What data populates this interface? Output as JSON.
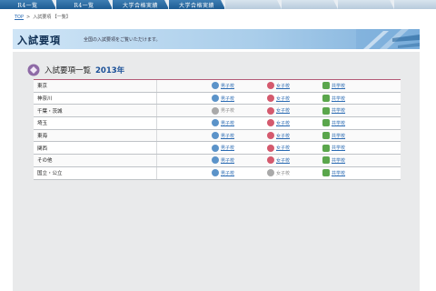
{
  "nav": {
    "tabs": [
      {
        "label": "R4一覧",
        "style": "dark"
      },
      {
        "label": "R4一覧",
        "style": "dark"
      },
      {
        "label": "大学合格実績",
        "style": "dark"
      },
      {
        "label": "大学合格実績",
        "style": "dark"
      },
      {
        "label": "",
        "style": "light"
      },
      {
        "label": "",
        "style": "light"
      },
      {
        "label": "",
        "style": "light"
      },
      {
        "label": "",
        "style": "light"
      }
    ]
  },
  "breadcrumb": {
    "top": "TOP",
    "separator": ">",
    "current": "入試要項 【一覧】"
  },
  "banner": {
    "title": "入試要項",
    "description": "全国の入試要項をご覧いただけます。"
  },
  "list": {
    "title": "入試要項一覧",
    "year": "2013年"
  },
  "labels": {
    "boys": "男子校",
    "girls": "女子校",
    "coed": "共学校"
  },
  "rows": [
    {
      "region": "東京",
      "boys": true,
      "girls": true,
      "coed": true
    },
    {
      "region": "神奈川",
      "boys": true,
      "girls": true,
      "coed": true
    },
    {
      "region": "千葉・茨城",
      "boys": false,
      "girls": true,
      "coed": true
    },
    {
      "region": "埼玉",
      "boys": true,
      "girls": true,
      "coed": true
    },
    {
      "region": "東海",
      "boys": true,
      "girls": true,
      "coed": true
    },
    {
      "region": "関西",
      "boys": true,
      "girls": true,
      "coed": true
    },
    {
      "region": "その他",
      "boys": true,
      "girls": true,
      "coed": true
    },
    {
      "region": "国立・公立",
      "boys": true,
      "girls": false,
      "coed": true
    }
  ],
  "colors": {
    "accent": "#2b6bb3",
    "year": "#1a4f97",
    "table_top_border": "#b45b78",
    "panel_bg": "#e9eaeb"
  }
}
